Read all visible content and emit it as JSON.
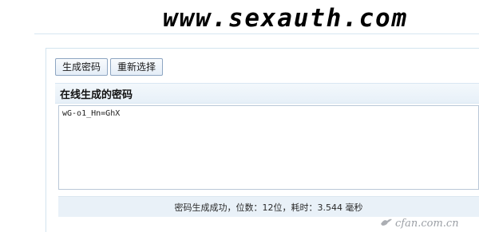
{
  "header": {
    "logo_text": "www.sexauth.com"
  },
  "toolbar": {
    "generate_label": "生成密码",
    "reselect_label": "重新选择"
  },
  "section": {
    "title": "在线生成的密码"
  },
  "output": {
    "value": "wG-o1_Hn=GhX"
  },
  "status": {
    "text": "密码生成成功，位数：12位，耗时：3.544 毫秒"
  },
  "watermark": {
    "text": "cfan.com.cn",
    "icon": "bird-icon"
  }
}
